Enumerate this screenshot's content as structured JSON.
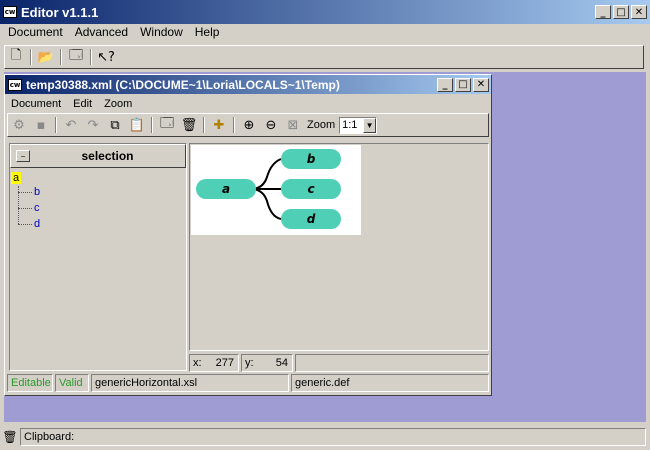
{
  "app": {
    "title": "Editor v1.1.1",
    "menu": [
      "Document",
      "Advanced",
      "Window",
      "Help"
    ]
  },
  "doc_window": {
    "title": "temp30388.xml  (C:\\DOCUME~1\\Loria\\LOCALS~1\\Temp)",
    "menu": [
      "Document",
      "Edit",
      "Zoom"
    ],
    "zoom_label": "Zoom",
    "zoom_value": "1:1",
    "selection_label": "selection",
    "tree": {
      "root": "a",
      "children": [
        "b",
        "c",
        "d"
      ]
    },
    "diagram": {
      "root": "a",
      "children": [
        "b",
        "c",
        "d"
      ]
    },
    "coords": {
      "x_label": "x:",
      "x_value": "277",
      "y_label": "y:",
      "y_value": "54"
    },
    "status": {
      "editable": "Editable",
      "valid": "Valid",
      "stylesheet": "genericHorizontal.xsl",
      "definition": "generic.def"
    }
  },
  "clipboard_label": "Clipboard:",
  "colors": {
    "desktop": "#9e9cd2",
    "status_green": "#2a9a2a",
    "node_fill": "#4fcfb5",
    "tree_link": "#0000c0"
  }
}
